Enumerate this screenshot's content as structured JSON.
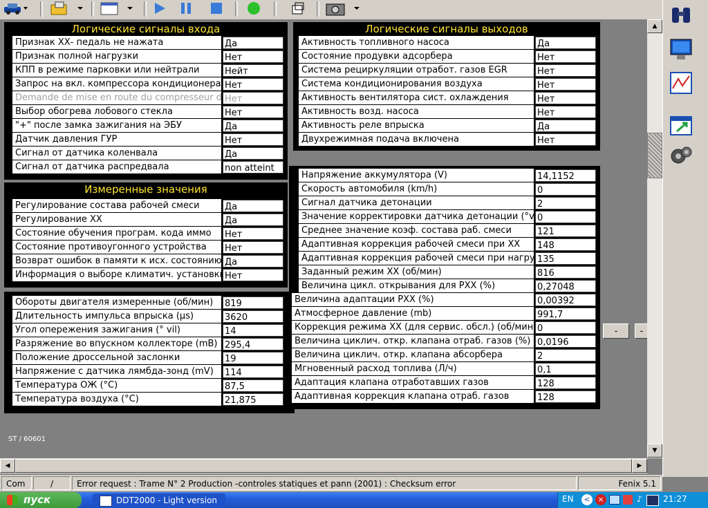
{
  "toolbar": {
    "icons": [
      "car-icon",
      "folder-open-icon",
      "window-icon",
      "play-icon",
      "pause-icon",
      "stop-icon",
      "green-light-icon",
      "restore-window-icon",
      "camera-icon"
    ]
  },
  "panels": {
    "inputs": {
      "title": "Логические сигналы входа",
      "rows": [
        {
          "label": "Признак ХХ- педаль не нажата",
          "value": "Да"
        },
        {
          "label": "Признак полной нагрузки",
          "value": "Нет"
        },
        {
          "label": "КПП в режиме парковки или нейтрали",
          "value": "Нейт"
        },
        {
          "label": "Запрос на вкл. компрессора кондиционера",
          "value": "Нет"
        },
        {
          "label": "Demande de mise en route du compresseur de clim",
          "value": "Нет"
        },
        {
          "label": "Выбор обогрева лобового стекла",
          "value": "Нет"
        },
        {
          "label": "\"+\" после замка зажигания на ЭБУ",
          "value": "Да"
        },
        {
          "label": "Датчик давления ГУР",
          "value": "Нет"
        },
        {
          "label": "Сигнал от датчика коленвала",
          "value": "Да"
        },
        {
          "label": "Сигнал от датчика распредвала",
          "value": "non atteint"
        }
      ]
    },
    "outputs": {
      "title": "Логические сигналы выходов",
      "rows": [
        {
          "label": "Активность топливного насоса",
          "value": "Да"
        },
        {
          "label": "Состояние продувки адсорбера",
          "value": "Нет"
        },
        {
          "label": "Система рециркуляции отработ. газов EGR",
          "value": "Нет"
        },
        {
          "label": "Система кондиционирования воздуха",
          "value": "Нет"
        },
        {
          "label": "Активность вентилятора сист. охлаждения",
          "value": "Нет"
        },
        {
          "label": "Активность возд. насоса",
          "value": "Нет"
        },
        {
          "label": "Активность реле впрыска",
          "value": "Да"
        },
        {
          "label": "Двухрежимная подача включена",
          "value": "Нет"
        }
      ]
    },
    "measured": {
      "title": "Измеренные значения",
      "rows": [
        {
          "label": "Регулирование состава рабочей смеси",
          "value": "Да"
        },
        {
          "label": "Регулирование ХХ",
          "value": "Да"
        },
        {
          "label": "Состояние обучения програм. кода иммо",
          "value": "Нет"
        },
        {
          "label": "Состояние противоугонного устройства",
          "value": "Нет"
        },
        {
          "label": "Возврат ошибок в памяти к исх. состоянию",
          "value": "Да"
        },
        {
          "label": "Информация о выборе климатич. установки",
          "value": "Нет"
        }
      ]
    },
    "engine": {
      "rows": [
        {
          "label": "Обороты двигателя измеренные (об/мин)",
          "value": "819"
        },
        {
          "label": "Длительность импульса впрыска (µs)",
          "value": "3620"
        },
        {
          "label": "Угол опережения зажигания (° vil)",
          "value": "14"
        },
        {
          "label": "Разряжение во впускном коллекторе (mB)",
          "value": "295,4"
        },
        {
          "label": "Положение дроссельной заслонки",
          "value": "19"
        },
        {
          "label": "Напряжение с датчика лямбда-зонд (mV)",
          "value": "114"
        },
        {
          "label": "Температура ОЖ (°C)",
          "value": "87,5"
        },
        {
          "label": "Температура воздуха (°C)",
          "value": "21,875"
        }
      ]
    },
    "params": {
      "rows": [
        {
          "label": "Напряжение аккумулятора (V)",
          "value": "14,1152"
        },
        {
          "label": "Скорость автомобиля (km/h)",
          "value": "0"
        },
        {
          "label": "Сигнал датчика детонации",
          "value": "2"
        },
        {
          "label": "Значение корректировки датчика детонации (°vil)",
          "value": "0"
        },
        {
          "label": "Среднее значение коэф. состава раб. смеси",
          "value": "121"
        },
        {
          "label": "Адаптивная коррекция рабочей смеси при ХХ",
          "value": "148"
        },
        {
          "label": "Адаптивная коррекция рабочей смеси при нагрузке",
          "value": "135"
        },
        {
          "label": "Заданный режим ХХ (об/мин)",
          "value": "816"
        },
        {
          "label": "Величина цикл. открывания для РХХ (%)",
          "value": "0,27048"
        },
        {
          "label": "Величина адаптации РХХ (%)",
          "value": "0,00392"
        },
        {
          "label": "Атмосферное давление (mb)",
          "value": "991,7"
        },
        {
          "label": "Коррекция режима ХХ (для сервис. обсл.) (об/мин)",
          "value": "0"
        },
        {
          "label": "Величина циклич. откр. клапана отраб. газов (%)",
          "value": "0,0196"
        },
        {
          "label": "Величина циклич. откр. клапана абсорбера",
          "value": "2"
        },
        {
          "label": "Мгновенный расход топлива (Л/ч)",
          "value": "0,1"
        },
        {
          "label": "Адаптация клапана отработавших газов",
          "value": "128"
        },
        {
          "label": "Адаптивная коррекция клапана отраб. газов",
          "value": "128"
        }
      ]
    }
  },
  "side_buttons": {
    "left": "-",
    "right": "-"
  },
  "footer_code": "ST / 60601",
  "status": {
    "com": "Com",
    "sep": "/",
    "message": "Error request : Trame N° 2 Production -controles statiques et pann (2001) : Checksum error",
    "version": "Fenix 5.1"
  },
  "taskbar": {
    "start": "пуск",
    "task": "DDT2000 - Light version",
    "lang": "EN",
    "clock": "21:27"
  },
  "colors": {
    "title": "#ffe433",
    "panel_bg": "#000000",
    "area_bg": "#808080"
  }
}
